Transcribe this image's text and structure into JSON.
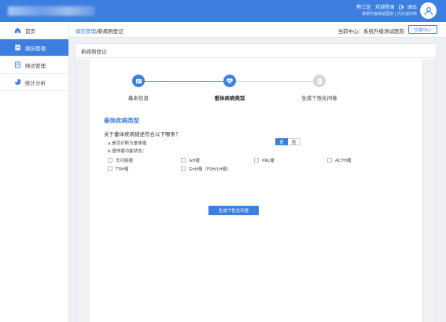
{
  "header": {
    "user_name": "韩三区",
    "welcome": "欢迎登录",
    "logout": "退出",
    "org_line": "系统升级测试医院 | 内分泌内科"
  },
  "sidebar": {
    "items": [
      {
        "label": "首页",
        "icon": "home-icon"
      },
      {
        "label": "病历管理",
        "icon": "record-icon"
      },
      {
        "label": "随访管理",
        "icon": "followup-icon"
      },
      {
        "label": "统计分析",
        "icon": "pie-chart-icon"
      }
    ],
    "active_index": 1
  },
  "breadcrumb": {
    "parent": "病历管理",
    "separator": "/",
    "current": "新病例登记"
  },
  "center": {
    "label": "当前中心：系统升级测试医院",
    "switch_label": "切换中心"
  },
  "card": {
    "title": "新病例登记"
  },
  "steps": [
    {
      "label": "基本信息",
      "status": "done"
    },
    {
      "label": "垂体疾病类型",
      "status": "current"
    },
    {
      "label": "生成个性化问卷",
      "status": "pending"
    }
  ],
  "form": {
    "section_title": "垂体疾病类型",
    "question": "关于垂体疾病描述符合以下哪条？",
    "sub_a": "a.是否诊断为垂体瘤",
    "yes_label": "是",
    "no_label": "否",
    "selected": "是",
    "sub_b": "b.垂体瘤功能状态：",
    "options_row1": [
      "无功能瘤",
      "GH瘤",
      "PRL瘤",
      "ACTH瘤"
    ],
    "options_row2": [
      "TSH瘤",
      "GnH瘤（FSH/LH瘤）"
    ],
    "submit_label": "生成个性化问卷"
  },
  "colors": {
    "primary": "#3d7fe0",
    "pending_step": "#d4d6dc"
  }
}
